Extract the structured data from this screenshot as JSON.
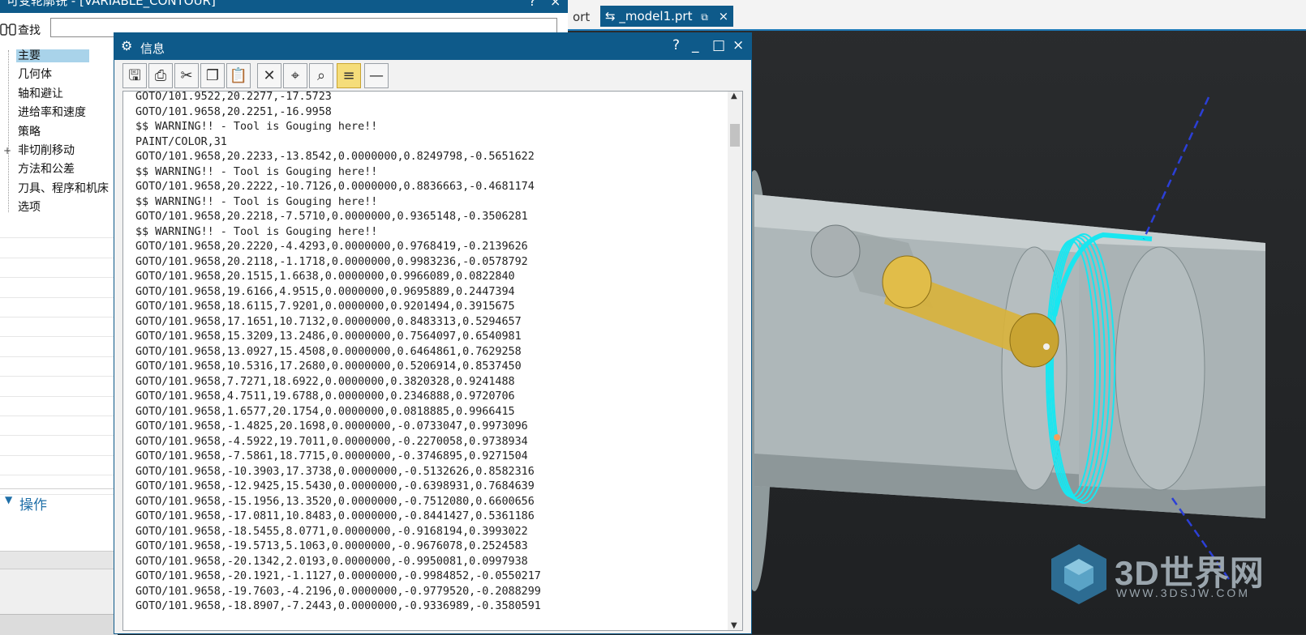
{
  "left_dialog": {
    "title": "可变轮廓铣 - [VARIABLE_CONTOUR]",
    "help": "?",
    "close": "×",
    "find_label": "查找",
    "find_value": "",
    "tree": [
      {
        "label": "主要",
        "selected": true
      },
      {
        "label": "几何体"
      },
      {
        "label": "轴和避让"
      },
      {
        "label": "进给率和速度"
      },
      {
        "label": "策略"
      },
      {
        "label": "非切削移动",
        "expander": "+"
      },
      {
        "label": "方法和公差"
      },
      {
        "label": "刀具、程序和机床"
      },
      {
        "label": "选项"
      }
    ],
    "operations_header": "操作"
  },
  "tabs": {
    "prev_label": "ort",
    "active_label": "_model1.prt",
    "active_close": "×"
  },
  "info_window": {
    "title": "信息",
    "help": "?",
    "minimize": "_",
    "maximize": "□",
    "close": "×",
    "toolbar": [
      {
        "name": "save-icon",
        "glyph": "🖫"
      },
      {
        "name": "print-icon",
        "glyph": "⎙"
      },
      {
        "name": "cut-icon",
        "glyph": "✂"
      },
      {
        "name": "copy-icon",
        "glyph": "❐"
      },
      {
        "name": "paste-icon",
        "glyph": "📋"
      },
      {
        "name": "delete-icon",
        "glyph": "✕"
      },
      {
        "name": "locate-icon",
        "glyph": "⌖"
      },
      {
        "name": "find-icon",
        "glyph": "⌕"
      },
      {
        "name": "word-wrap-icon",
        "glyph": "≡",
        "active": true
      },
      {
        "name": "minus-icon",
        "glyph": "—"
      }
    ],
    "lines": [
      "GOTO/101.9522,20.2277,-17.5723",
      "GOTO/101.9658,20.2251,-16.9958",
      "$$ WARNING!! - Tool is Gouging here!!",
      "PAINT/COLOR,31",
      "GOTO/101.9658,20.2233,-13.8542,0.0000000,0.8249798,-0.5651622",
      "$$ WARNING!! - Tool is Gouging here!!",
      "GOTO/101.9658,20.2222,-10.7126,0.0000000,0.8836663,-0.4681174",
      "$$ WARNING!! - Tool is Gouging here!!",
      "GOTO/101.9658,20.2218,-7.5710,0.0000000,0.9365148,-0.3506281",
      "$$ WARNING!! - Tool is Gouging here!!",
      "GOTO/101.9658,20.2220,-4.4293,0.0000000,0.9768419,-0.2139626",
      "GOTO/101.9658,20.2118,-1.1718,0.0000000,0.9983236,-0.0578792",
      "GOTO/101.9658,20.1515,1.6638,0.0000000,0.9966089,0.0822840",
      "GOTO/101.9658,19.6166,4.9515,0.0000000,0.9695889,0.2447394",
      "GOTO/101.9658,18.6115,7.9201,0.0000000,0.9201494,0.3915675",
      "GOTO/101.9658,17.1651,10.7132,0.0000000,0.8483313,0.5294657",
      "GOTO/101.9658,15.3209,13.2486,0.0000000,0.7564097,0.6540981",
      "GOTO/101.9658,13.0927,15.4508,0.0000000,0.6464861,0.7629258",
      "GOTO/101.9658,10.5316,17.2680,0.0000000,0.5206914,0.8537450",
      "GOTO/101.9658,7.7271,18.6922,0.0000000,0.3820328,0.9241488",
      "GOTO/101.9658,4.7511,19.6788,0.0000000,0.2346888,0.9720706",
      "GOTO/101.9658,1.6577,20.1754,0.0000000,0.0818885,0.9966415",
      "GOTO/101.9658,-1.4825,20.1698,0.0000000,-0.0733047,0.9973096",
      "GOTO/101.9658,-4.5922,19.7011,0.0000000,-0.2270058,0.9738934",
      "GOTO/101.9658,-7.5861,18.7715,0.0000000,-0.3746895,0.9271504",
      "GOTO/101.9658,-10.3903,17.3738,0.0000000,-0.5132626,0.8582316",
      "GOTO/101.9658,-12.9425,15.5430,0.0000000,-0.6398931,0.7684639",
      "GOTO/101.9658,-15.1956,13.3520,0.0000000,-0.7512080,0.6600656",
      "GOTO/101.9658,-17.0811,10.8483,0.0000000,-0.8441427,0.5361186",
      "GOTO/101.9658,-18.5455,8.0771,0.0000000,-0.9168194,0.3993022",
      "GOTO/101.9658,-19.5713,5.1063,0.0000000,-0.9676078,0.2524583",
      "GOTO/101.9658,-20.1342,2.0193,0.0000000,-0.9950081,0.0997938",
      "GOTO/101.9658,-20.1921,-1.1127,0.0000000,-0.9984852,-0.0550217",
      "GOTO/101.9658,-19.7603,-4.2196,0.0000000,-0.9779520,-0.2088299",
      "GOTO/101.9658,-18.8907,-7.2443,0.0000000,-0.9336989,-0.3580591"
    ]
  },
  "watermark": {
    "brand": "3D世界网",
    "site": "WWW.3DSJW.COM"
  },
  "colors": {
    "title_bar": "#0e5a8a",
    "selection": "#a9d3ea",
    "toolpath": "#19e6f0",
    "tool": "#d9b23a",
    "axis_line": "#2b3fd6"
  }
}
